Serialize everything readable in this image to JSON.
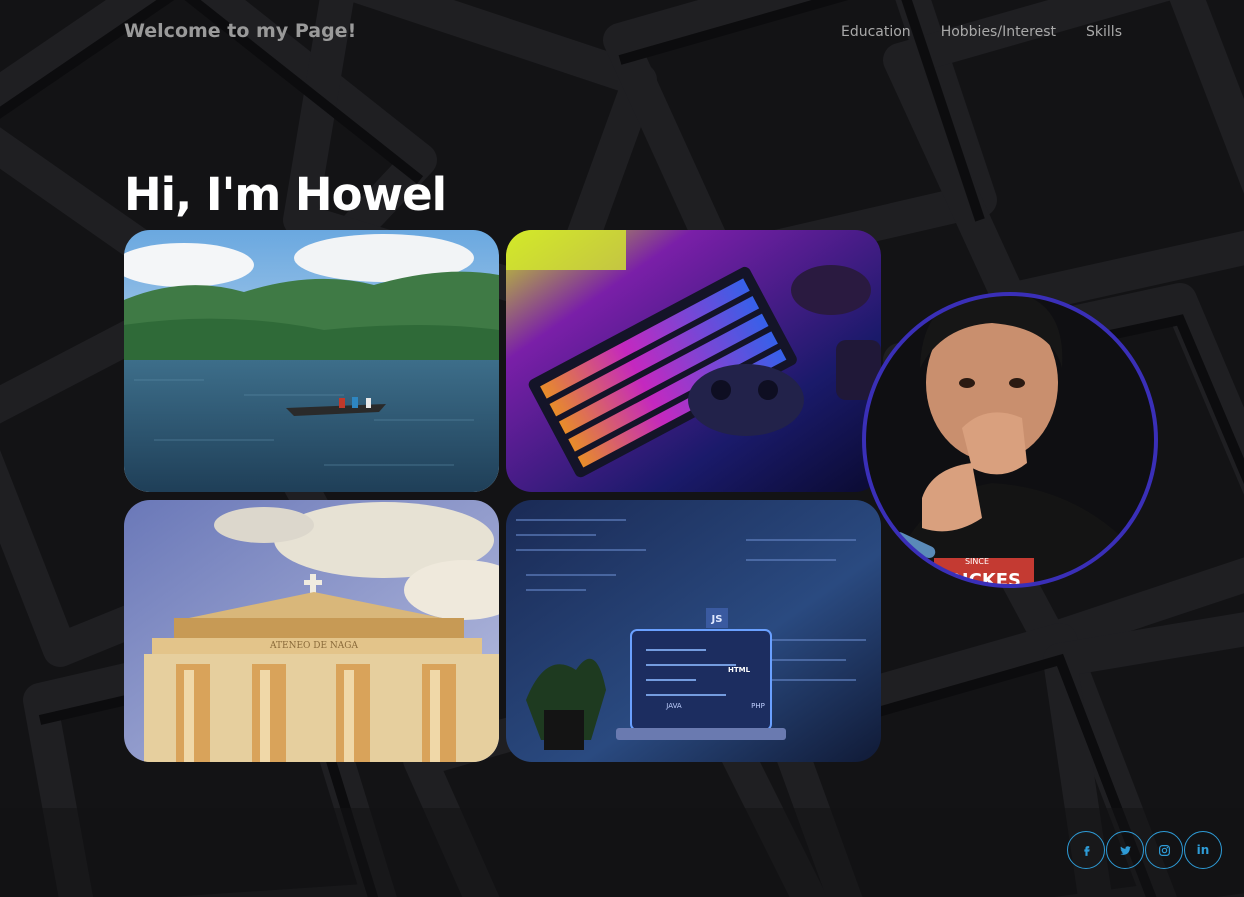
{
  "nav": {
    "brand": "Welcome to my Page!",
    "links": [
      "Education",
      "Hobbies/Interest",
      "Skills"
    ]
  },
  "hero": {
    "title": "Hi, I'm Howel"
  },
  "gallery": {
    "church_sign": "ATENEO DE NAGA",
    "coding_labels": [
      "JS",
      "HTML",
      "JAVA",
      "PHP"
    ]
  },
  "avatar": {
    "shirt_text": "DICKES",
    "shirt_small": "SINCE"
  },
  "social": {
    "icons": [
      "facebook-icon",
      "twitter-icon",
      "instagram-icon",
      "linkedin-icon"
    ],
    "linkedin_label": "in"
  },
  "colors": {
    "background": "#121214",
    "accent": "#2e9bd6",
    "avatar_ring": "#3a2fb8"
  }
}
